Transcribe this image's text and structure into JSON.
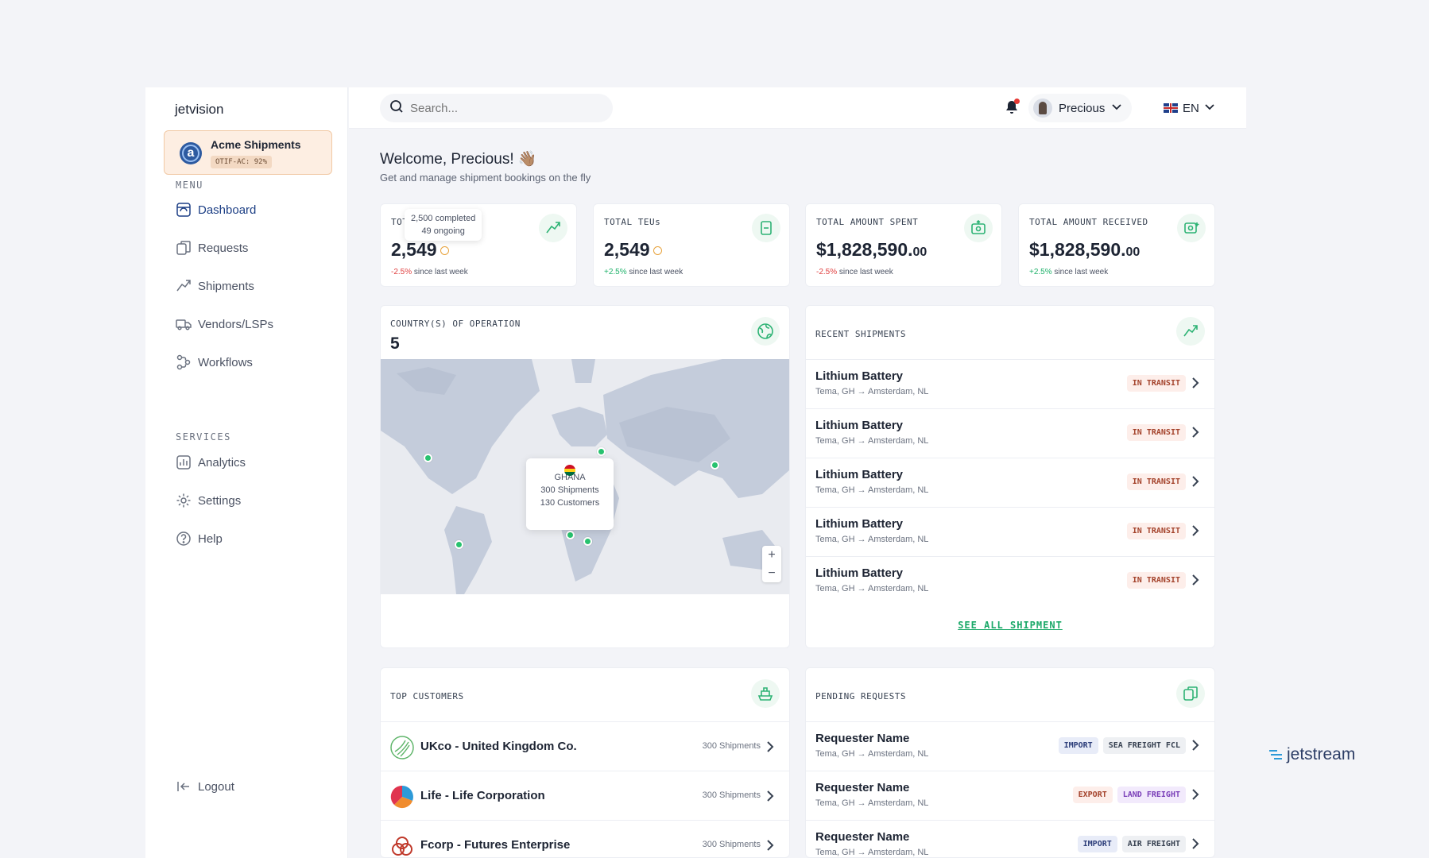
{
  "sidebar": {
    "brand": "jetvision",
    "org": {
      "name": "Acme Shipments",
      "badge": "OTIF-AC: 92%"
    },
    "menu_label": "MENU",
    "menu": [
      {
        "label": "Dashboard",
        "icon": "dashboard-icon",
        "active": true
      },
      {
        "label": "Requests",
        "icon": "requests-icon"
      },
      {
        "label": "Shipments",
        "icon": "shipments-icon"
      },
      {
        "label": "Vendors/LSPs",
        "icon": "truck-icon"
      },
      {
        "label": "Workflows",
        "icon": "workflow-icon"
      }
    ],
    "services_label": "SERVICES",
    "services": [
      {
        "label": "Analytics",
        "icon": "analytics-icon"
      },
      {
        "label": "Settings",
        "icon": "gear-icon"
      },
      {
        "label": "Help",
        "icon": "help-icon"
      }
    ],
    "logout": "Logout"
  },
  "topbar": {
    "search_placeholder": "Search...",
    "user": "Precious",
    "language": "EN"
  },
  "header": {
    "welcome": "Welcome, Precious! 👋🏽",
    "subtitle": "Get and manage shipment bookings on the fly"
  },
  "stats": [
    {
      "label": "TOT",
      "value": "2,549",
      "change": "-2.5%",
      "change_suffix": "since last week",
      "tooltip_1": "2,500 completed",
      "tooltip_2": "49 ongoing"
    },
    {
      "label": "TOTAL TEUs",
      "value": "2,549",
      "change": "+2.5%",
      "change_suffix": "since last week"
    },
    {
      "label": "TOTAL AMOUNT SPENT",
      "value_main": "$1,828,590.",
      "value_cents": "00",
      "change": "-2.5%",
      "change_suffix": "since last week"
    },
    {
      "label": "TOTAL AMOUNT RECEIVED",
      "value_main": "$1,828,590.",
      "value_cents": "00",
      "change": "+2.5%",
      "change_suffix": "since last week"
    }
  ],
  "countries": {
    "title": "COUNTRY(S) OF OPERATION",
    "count": "5",
    "tooltip": {
      "country": "GHANA",
      "shipments": "300 Shipments",
      "customers": "130 Customers"
    },
    "zoom_in": "+",
    "zoom_out": "−"
  },
  "recent_shipments": {
    "title": "RECENT SHIPMENTS",
    "items": [
      {
        "name": "Lithium Battery",
        "route": "Tema, GH → Amsterdam, NL",
        "status": "IN TRANSIT"
      },
      {
        "name": "Lithium Battery",
        "route": "Tema, GH → Amsterdam, NL",
        "status": "IN TRANSIT"
      },
      {
        "name": "Lithium Battery",
        "route": "Tema, GH → Amsterdam, NL",
        "status": "IN TRANSIT"
      },
      {
        "name": "Lithium Battery",
        "route": "Tema, GH → Amsterdam, NL",
        "status": "IN TRANSIT"
      },
      {
        "name": "Lithium Battery",
        "route": "Tema, GH → Amsterdam, NL",
        "status": "IN TRANSIT"
      }
    ],
    "see_all": "SEE ALL SHIPMENT"
  },
  "top_customers": {
    "title": "TOP CUSTOMERS",
    "items": [
      {
        "name": "UKco - United Kingdom Co.",
        "count": "300 Shipments"
      },
      {
        "name": "Life - Life Corporation",
        "count": "300 Shipments"
      },
      {
        "name": "Fcorp - Futures Enterprise",
        "count": "300 Shipments"
      }
    ]
  },
  "pending_requests": {
    "title": "PENDING REQUESTS",
    "items": [
      {
        "name": "Requester Name",
        "route": "Tema, GH → Amsterdam, NL",
        "tag1": "IMPORT",
        "tag2": "SEA FREIGHT FCL"
      },
      {
        "name": "Requester Name",
        "route": "Tema, GH → Amsterdam, NL",
        "tag1": "EXPORT",
        "tag2": "LAND FREIGHT"
      },
      {
        "name": "Requester Name",
        "route": "Tema, GH → Amsterdam, NL",
        "tag1": "IMPORT",
        "tag2": "AIR FREIGHT"
      }
    ]
  },
  "watermark": "jetstream",
  "colors": {
    "accent_green": "#2db374",
    "brand_blue": "#1d3f85",
    "negative": "#e04040",
    "positive": "#20b26b"
  }
}
